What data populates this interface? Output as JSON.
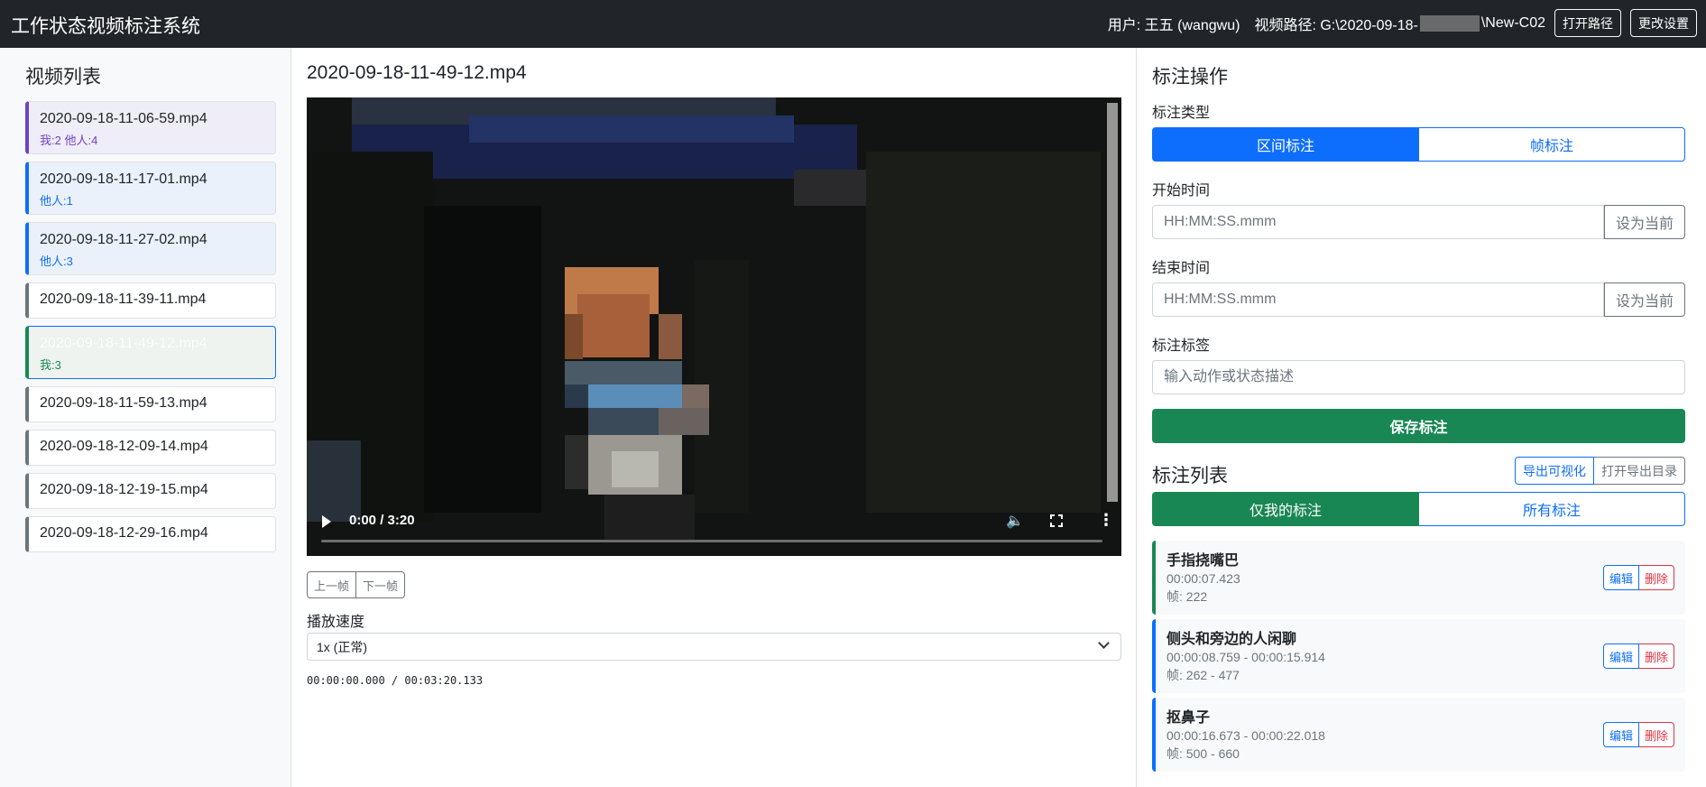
{
  "header": {
    "title": "工作状态视频标注系统",
    "user": "用户: 王五 (wangwu)",
    "path_prefix": "视频路径: G:\\2020-09-18-",
    "path_suffix": "\\New-C02",
    "open_path_btn": "打开路径",
    "settings_btn": "更改设置"
  },
  "sidebar": {
    "title": "视频列表",
    "videos": [
      {
        "name": "2020-09-18-11-06-59.mp4",
        "meta": "我:2 他人:4"
      },
      {
        "name": "2020-09-18-11-17-01.mp4",
        "meta": "他人:1"
      },
      {
        "name": "2020-09-18-11-27-02.mp4",
        "meta": "他人:3"
      },
      {
        "name": "2020-09-18-11-39-11.mp4"
      },
      {
        "name": "2020-09-18-11-49-12.mp4",
        "meta": "我:3"
      },
      {
        "name": "2020-09-18-11-59-13.mp4"
      },
      {
        "name": "2020-09-18-12-09-14.mp4"
      },
      {
        "name": "2020-09-18-12-19-15.mp4"
      },
      {
        "name": "2020-09-18-12-29-16.mp4"
      }
    ]
  },
  "player": {
    "title": "2020-09-18-11-49-12.mp4",
    "time_display": "0:00 / 3:20",
    "prev_frame": "上一帧",
    "next_frame": "下一帧",
    "speed_label": "播放速度",
    "speed_value": "1x (正常)",
    "timecode": "00:00:00.000 / 00:03:20.133"
  },
  "annotate": {
    "title": "标注操作",
    "type_label": "标注类型",
    "type_interval": "区间标注",
    "type_frame": "帧标注",
    "start_label": "开始时间",
    "start_placeholder": "HH:MM:SS.mmm",
    "end_label": "结束时间",
    "end_placeholder": "HH:MM:SS.mmm",
    "set_current": "设为当前",
    "tag_label": "标注标签",
    "tag_placeholder": "输入动作或状态描述",
    "save_btn": "保存标注"
  },
  "anno_list": {
    "title": "标注列表",
    "export_vis": "导出可视化",
    "open_export_dir": "打开导出目录",
    "filter_mine": "仅我的标注",
    "filter_all": "所有标注",
    "edit": "编辑",
    "delete": "删除",
    "items": [
      {
        "label": "手指挠嘴巴",
        "time": "00:00:07.423",
        "frames": "帧: 222"
      },
      {
        "label": "侧头和旁边的人闲聊",
        "time": "00:00:08.759 - 00:00:15.914",
        "frames": "帧: 262 - 477"
      },
      {
        "label": "抠鼻子",
        "time": "00:00:16.673 - 00:00:22.018",
        "frames": "帧: 500 - 660"
      }
    ]
  }
}
